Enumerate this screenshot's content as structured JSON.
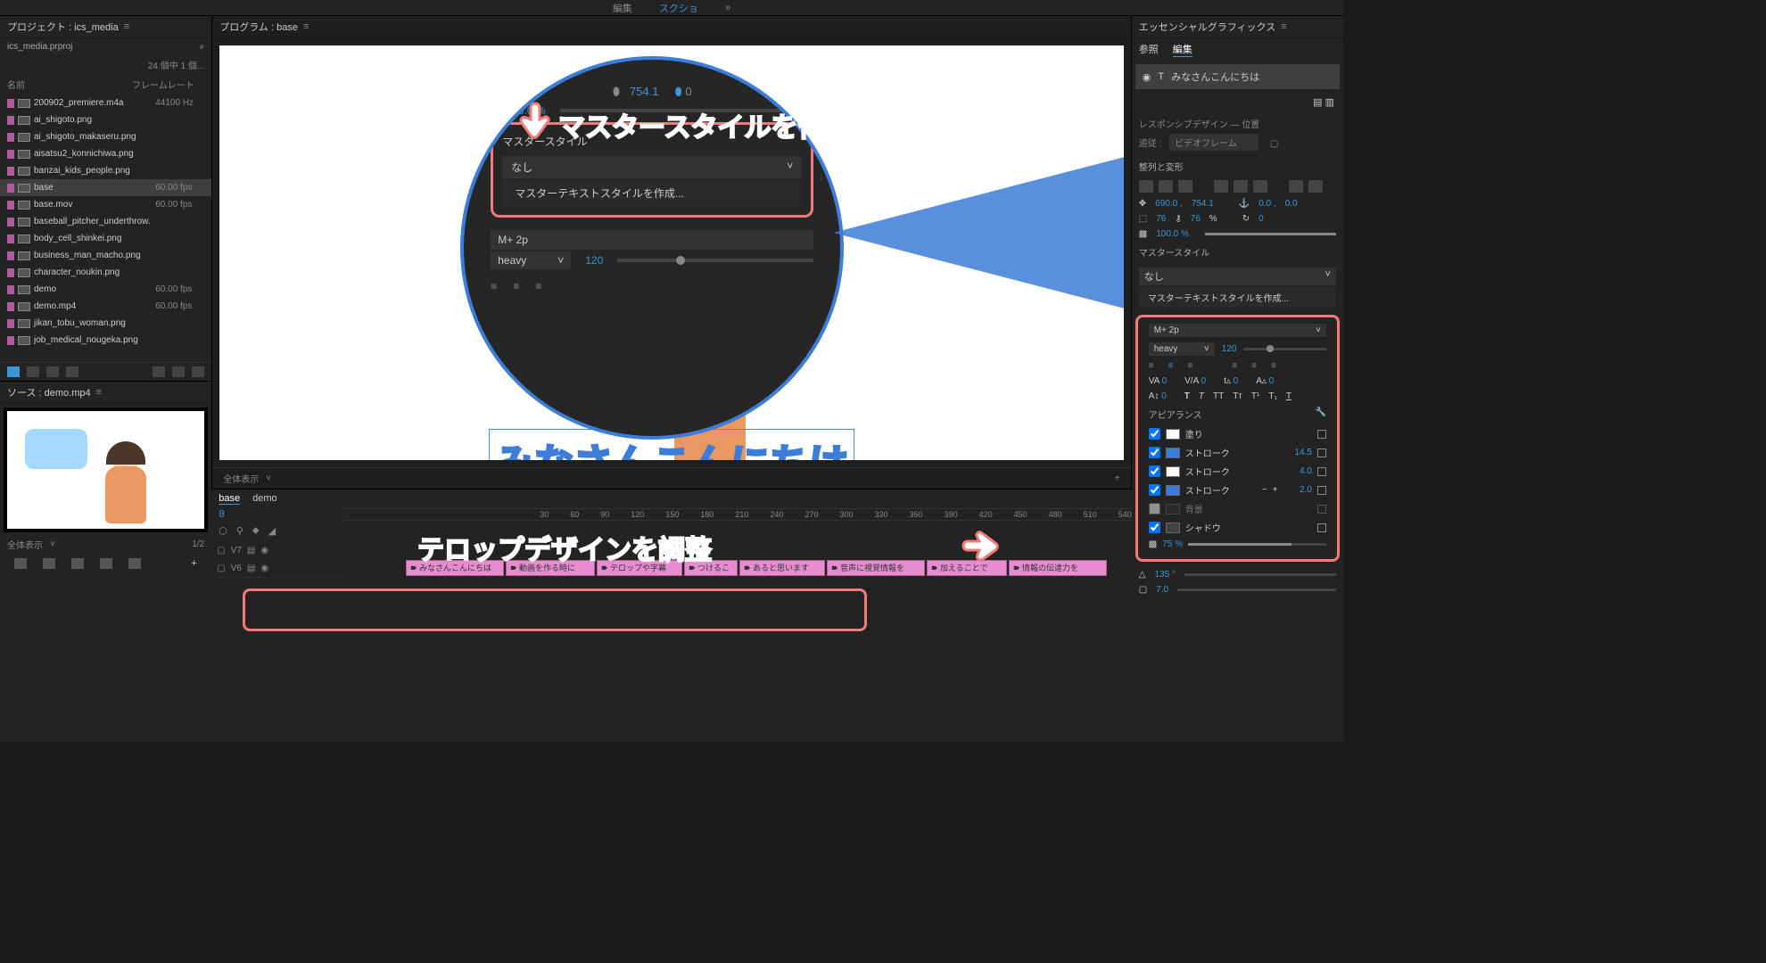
{
  "topbar": {
    "tab1": "編集",
    "tab2": "スクショ",
    "overflow": "»"
  },
  "project": {
    "title": "プロジェクト : ics_media",
    "file": "ics_media.prproj",
    "count": "24 個中 1 個...",
    "col_name": "名前",
    "col_fps": "フレームレート",
    "items": [
      {
        "chip": "#b05aa0",
        "name": "200902_premiere.m4a",
        "fr": "44100 Hz"
      },
      {
        "chip": "#b05aa0",
        "name": "ai_shigoto.png",
        "fr": ""
      },
      {
        "chip": "#b05aa0",
        "name": "ai_shigoto_makaseru.png",
        "fr": ""
      },
      {
        "chip": "#b05aa0",
        "name": "aisatsu2_konnichiwa.png",
        "fr": ""
      },
      {
        "chip": "#b05aa0",
        "name": "banzai_kids_people.png",
        "fr": ""
      },
      {
        "chip": "#b05aa0",
        "name": "base",
        "fr": "60.00 fps",
        "sel": true
      },
      {
        "chip": "#b05aa0",
        "name": "base.mov",
        "fr": "60.00 fps"
      },
      {
        "chip": "#b05aa0",
        "name": "baseball_pitcher_underthrow.",
        "fr": ""
      },
      {
        "chip": "#b05aa0",
        "name": "body_cell_shinkei.png",
        "fr": ""
      },
      {
        "chip": "#b05aa0",
        "name": "business_man_macho.png",
        "fr": ""
      },
      {
        "chip": "#b05aa0",
        "name": "character_noukin.png",
        "fr": ""
      },
      {
        "chip": "#b05aa0",
        "name": "demo",
        "fr": "60.00 fps"
      },
      {
        "chip": "#b05aa0",
        "name": "demo.mp4",
        "fr": "60.00 fps"
      },
      {
        "chip": "#b05aa0",
        "name": "jikan_tobu_woman.png",
        "fr": ""
      },
      {
        "chip": "#b05aa0",
        "name": "job_medical_nougeka.png",
        "fr": ""
      }
    ]
  },
  "source": {
    "title": "ソース : demo.mp4",
    "fit": "全体表示",
    "pages": "1/2"
  },
  "program": {
    "title": "プログラム : base",
    "text": "みなさんこんにちは",
    "fit": "全体表示"
  },
  "zoom": {
    "pct": "100.0 %",
    "x754": "754.1",
    "section": "マスタースタイル",
    "none": "なし",
    "create": "マスターテキストスタイルを作成...",
    "font": "M+ 2p",
    "weight": "heavy",
    "slider": "120"
  },
  "timeline": {
    "tabs": {
      "base": "base",
      "demo": "demo"
    },
    "tc": "0",
    "ruler": [
      "30",
      "60",
      "90",
      "120",
      "150",
      "180",
      "210",
      "240",
      "270",
      "300",
      "330",
      "360",
      "390",
      "420",
      "450",
      "480",
      "510",
      "540"
    ],
    "tracks": [
      "V7",
      "V6"
    ],
    "clips": [
      "みなさんこんにちは",
      "動画を作る時に",
      "テロップや字幕",
      "つけるこ",
      "あると思います",
      "音声に視覚情報を",
      "加えることで",
      "情報の伝達力を"
    ]
  },
  "eg": {
    "title": "エッセンシャルグラフィックス",
    "tab_ref": "参照",
    "tab_edit": "編集",
    "layer": "みなさんこんにちは",
    "responsive": {
      "title": "レスポンシブデザイン — 位置",
      "follow": "追従 :",
      "value": "ビデオフレーム"
    },
    "align_title": "整列と変形",
    "pos": {
      "x": "690.0 ,",
      "y": "754.1",
      "ax": "0.0 ,",
      "ay": "0.0"
    },
    "sizewh": {
      "w": "76",
      "h": "76",
      "pct": "%",
      "rot": "0"
    },
    "opacity": "100.0 %",
    "master": {
      "title": "マスタースタイル",
      "none": "なし",
      "create": "マスターテキストスタイルを作成..."
    },
    "font": {
      "family": "M+ 2p",
      "weight": "heavy",
      "slider": "120"
    },
    "kern": {
      "va1": "0",
      "va2": "0",
      "ta": "0",
      "aa": "0",
      "baseline": "0"
    },
    "appearance": {
      "title": "アピアランス",
      "fill": {
        "label": "塗り"
      },
      "stroke1": {
        "label": "ストローク",
        "val": "14.5"
      },
      "stroke2": {
        "label": "ストローク",
        "val": "4.0"
      },
      "stroke3": {
        "label": "ストローク",
        "val": "2.0"
      },
      "bg": {
        "label": "背景"
      },
      "shadow": {
        "label": "シャドウ"
      },
      "tex": "75 %"
    },
    "misc": {
      "angle": "135 °",
      "box": "7.0"
    }
  },
  "annotations": {
    "a1": "マスタースタイルを作成",
    "a2": "テロップデザインを調整"
  }
}
